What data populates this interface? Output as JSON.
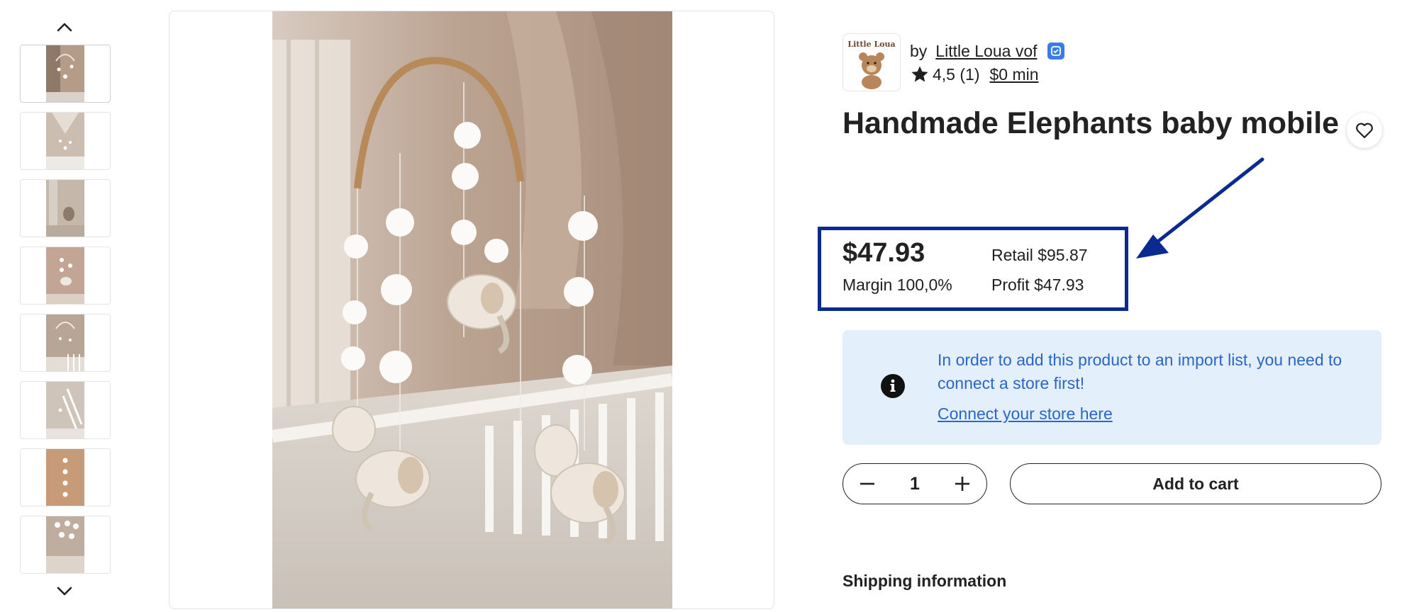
{
  "rail": {
    "up_icon": "chevron-up-icon",
    "down_icon": "chevron-down-icon",
    "thumb_count": 8
  },
  "vendor": {
    "by": "by",
    "name": "Little Loua vof",
    "logo_text": "Little Loua",
    "verified_icon": "verified-badge-icon",
    "rating": "4,5 (1)",
    "min_order": "$0 min"
  },
  "product": {
    "title": "Handmade Elephants baby mobile",
    "wishlist_icon": "heart-icon"
  },
  "pricing": {
    "price": "$47.93",
    "retail": "Retail $95.87",
    "margin": "Margin 100,0%",
    "profit": "Profit $47.93",
    "highlight_color": "#0a2a8f"
  },
  "notice": {
    "message": "In order to add this product to an import list, you need to connect a store first!",
    "link": "Connect your store here",
    "icon": "info-icon"
  },
  "purchase": {
    "quantity": "1",
    "add_to_cart": "Add to cart"
  },
  "shipping": {
    "heading": "Shipping information"
  }
}
